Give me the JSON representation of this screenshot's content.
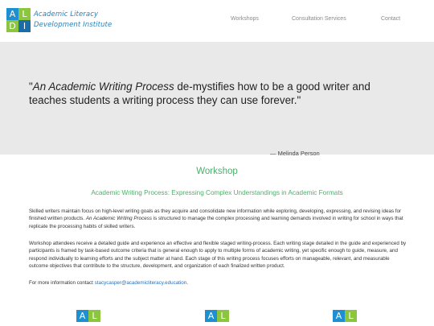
{
  "logo": {
    "letters": [
      "A",
      "L",
      "D",
      "I"
    ],
    "brand_line_1": "Academic Literacy",
    "brand_line_2": "Development Institute",
    "colors": {
      "blue": "#1e8fd0",
      "green": "#8cc63f",
      "dark_blue": "#1a6ea8"
    }
  },
  "nav": {
    "items": [
      {
        "label": "Workshops"
      },
      {
        "label": "Consultation Services"
      },
      {
        "label": "Contact"
      }
    ]
  },
  "hero": {
    "quote_open": "\"",
    "quote_title": "An Academic Writing Process",
    "quote_rest": " de-mystifies how to be a good writer and teaches students a writing process they can use forever.\"",
    "attribution": "— Melinda Person"
  },
  "main": {
    "section_title": "Workshop",
    "subtitle": "Academic Writing Process: Expressing Complex Understandings in Academic Formats",
    "para1_a": "Skilled writers maintain focus on high-level writing goals as they acquire and consolidate new information while exploring, developing, expressing, and revising ideas for finished written products. ",
    "para1_em": "An Academic Writing Process",
    "para1_b": " is structured to manage the complex processing and learning demands involved in writing for school in ways that replicate the processing habits of skilled writers.",
    "para2": "Workshop attendees receive a detailed guide and experience an effective and flexible staged writing-process. Each writing stage detailed in the guide and experienced by participants is framed by task-based outcome criteria that is general enough to apply to multiple forms of academic writing, yet specific enough to guide, measure, and respond individually to learning efforts and the subject matter at hand. Each stage of this writing process focuses efforts on manageable, relevant, and measurable outcome objectives that contribute to the structure, development, and organization of each finalized written product.",
    "contact_prefix": "For more information contact ",
    "contact_email": "stacycasper@academicliteracy.education",
    "contact_suffix": "."
  },
  "accent_color": "#4caf6a"
}
